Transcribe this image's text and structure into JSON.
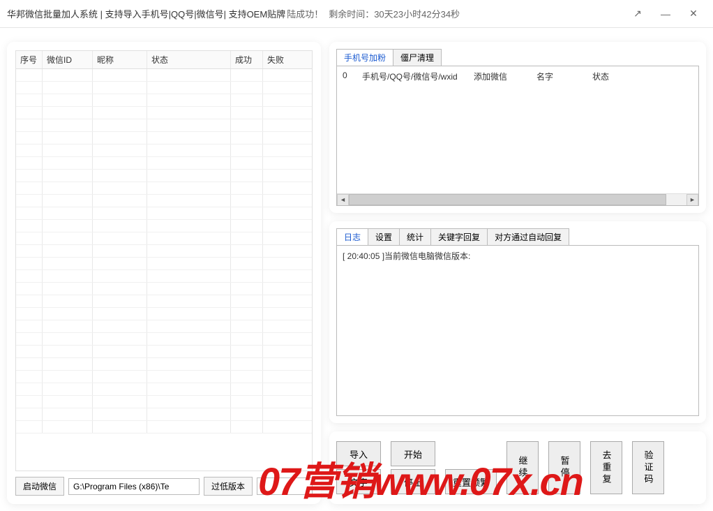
{
  "titlebar": {
    "title": "华邦微信批量加人系统   | 支持导入手机号|QQ号|微信号| 支持OEM贴牌",
    "status": "陆成功！",
    "remaining": "剩余时间：30天23小时42分34秒"
  },
  "left": {
    "columns": [
      "序号",
      "微信ID",
      "昵称",
      "状态",
      "成功",
      "失败"
    ],
    "start_wechat_btn": "启动微信",
    "path_value": "G:\\Program Files (x86)\\Te",
    "low_version_btn": "过低版本"
  },
  "right_top": {
    "tabs": [
      "手机号加粉",
      "僵尸清理"
    ],
    "active_tab": 0,
    "columns": [
      "0",
      "手机号/QQ号/微信号/wxid",
      "添加微信",
      "名字",
      "状态"
    ]
  },
  "right_mid": {
    "tabs": [
      "日志",
      "设置",
      "统计",
      "关键字回复",
      "对方通过自动回复"
    ],
    "active_tab": 0,
    "log_line": "[ 20:40:05 ]当前微信电脑微信版本:"
  },
  "right_bottom": {
    "import": "导入",
    "start": "开始",
    "text": "文字",
    "stop": "停止",
    "reset_freq": "重置频繁",
    "continue": "继续",
    "pause": "暂停",
    "dedup": "去重复",
    "verify": "验证码"
  },
  "watermark": "07营销www.07x.cn"
}
